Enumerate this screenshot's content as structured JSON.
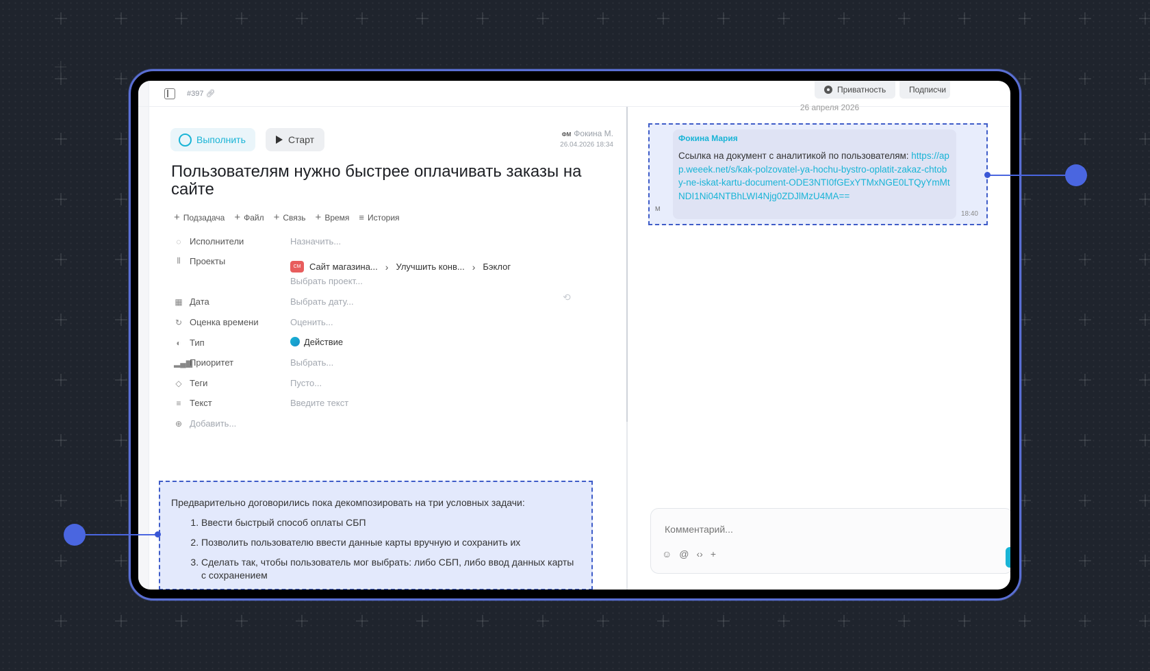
{
  "topbar": {
    "task_id": "#397",
    "privacy_label": "Приватность",
    "subscribe_label": "Подписчи"
  },
  "task": {
    "complete_label": "Выполнить",
    "start_label": "Старт",
    "author_initials": "ФМ",
    "author_name": "Фокина М.",
    "created_at": "26.04.2026 18:34",
    "title": "Пользователям нужно быстрее оплачивать заказы на сайте"
  },
  "actions": [
    {
      "label": "Подзадача"
    },
    {
      "label": "Файл"
    },
    {
      "label": "Связь"
    },
    {
      "label": "Время"
    },
    {
      "label": "История"
    }
  ],
  "fields": {
    "assignees": {
      "label": "Исполнители",
      "value": "Назначить..."
    },
    "projects": {
      "label": "Проекты",
      "badge": "СМ",
      "path": [
        "Сайт магазина...",
        "Улучшить конв...",
        "Бэклог"
      ],
      "add": "Выбрать проект..."
    },
    "date": {
      "label": "Дата",
      "value": "Выбрать дату..."
    },
    "estimate": {
      "label": "Оценка времени",
      "value": "Оценить..."
    },
    "type": {
      "label": "Тип",
      "value": "Действие"
    },
    "priority": {
      "label": "Приоритет",
      "value": "Выбрать..."
    },
    "tags": {
      "label": "Теги",
      "value": "Пусто..."
    },
    "text": {
      "label": "Текст",
      "value": "Введите текст"
    },
    "add": {
      "label": "Добавить..."
    }
  },
  "description": {
    "intro": "Предварительно договорились пока декомпозировать на три условных задачи:",
    "items": [
      "Ввести быстрый способ оплаты СБП",
      "Позволить пользователю ввести данные карты вручную и сохранить их",
      "Сделать так, чтобы пользователь мог выбрать: либо СБП, либо ввод данных карты с сохранением"
    ]
  },
  "chat": {
    "day": "26 апреля 2026",
    "message": {
      "author": "Фокина Мария",
      "text": "Ссылка на документ с аналитикой по пользователям: ",
      "link": "https://app.weeek.net/s/kak-polzovatel-ya-hochu-bystro-oplatit-zakaz-chtoby-ne-iskat-kartu-document-ODE3NTI0fGExYTMxNGE0LTQyYmMtNDI1Ni04NTBhLWI4Njg0ZDJlMzU4MA==",
      "time": "18:40",
      "avatar": "М"
    },
    "comment_placeholder": "Комментарий..."
  },
  "colors": {
    "accent": "#19b4d6",
    "annotation": "#4a66e0",
    "background": "#1f242d"
  }
}
